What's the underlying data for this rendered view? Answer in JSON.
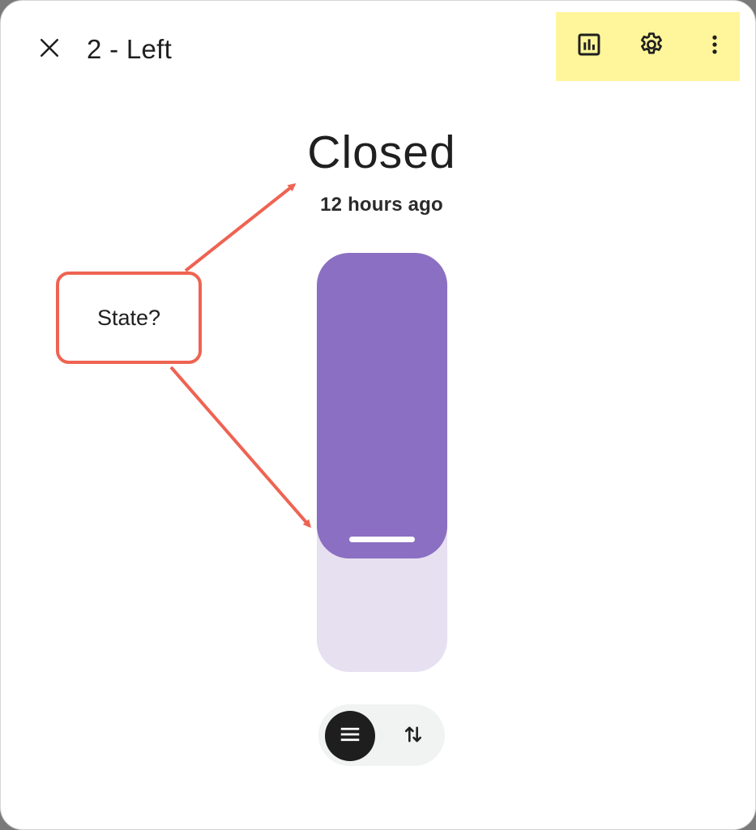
{
  "header": {
    "title": "2 - Left",
    "close_icon": "close-icon",
    "actions": [
      {
        "name": "history",
        "icon": "bar-chart-icon"
      },
      {
        "name": "settings",
        "icon": "gear-icon"
      },
      {
        "name": "more",
        "icon": "more-vert-icon"
      }
    ]
  },
  "state": {
    "label": "Closed",
    "last_changed": "12 hours ago"
  },
  "slider": {
    "open_fraction": 0.27,
    "fill_color": "#8b6fc2",
    "track_color": "#e7e0f1"
  },
  "mode_toggle": {
    "options": [
      {
        "icon": "menu-icon",
        "selected": true
      },
      {
        "icon": "swap-vert-icon",
        "selected": false
      }
    ]
  },
  "annotation": {
    "text": "State?",
    "color": "#ee6352"
  },
  "colors": {
    "toolbar_highlight": "#fff59a"
  }
}
